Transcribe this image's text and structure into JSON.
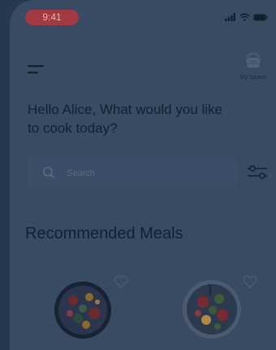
{
  "status": {
    "time": "9:41",
    "signal_icon": "signal-icon",
    "wifi_icon": "wifi-icon",
    "battery_icon": "battery-icon"
  },
  "header": {
    "menu_icon": "menu-icon",
    "basket_icon": "basket-icon",
    "basket_label": "My basket"
  },
  "greeting": "Hello Alice, What would you like to cook today?",
  "search": {
    "placeholder": "Search",
    "value": ""
  },
  "section": {
    "title": "Recommended Meals"
  },
  "meals": [
    {
      "image_icon": "meal-bowl-image",
      "favorite_icon": "heart-icon"
    },
    {
      "image_icon": "meal-bowl-image",
      "favorite_icon": "heart-icon"
    }
  ],
  "colors": {
    "overlay_dim": "#27374e",
    "screen": "#394a63",
    "time_pill": "#a33a43",
    "text": "#15202f"
  }
}
